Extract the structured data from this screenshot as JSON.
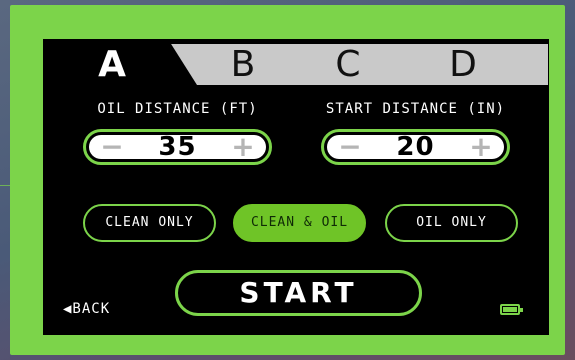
{
  "tabs": [
    {
      "label": "A",
      "active": true
    },
    {
      "label": "B",
      "active": false
    },
    {
      "label": "C",
      "active": false
    },
    {
      "label": "D",
      "active": false
    }
  ],
  "oil_distance": {
    "label": "OIL DISTANCE (FT)",
    "value": "35",
    "minus": "−",
    "plus": "+"
  },
  "start_distance": {
    "label": "START DISTANCE (IN)",
    "value": "20",
    "minus": "−",
    "plus": "+"
  },
  "modes": [
    {
      "label": "CLEAN ONLY",
      "selected": false
    },
    {
      "label": "CLEAN & OIL",
      "selected": true
    },
    {
      "label": "OIL ONLY",
      "selected": false
    }
  ],
  "start_label": "START",
  "back_label": "◀BACK",
  "battery": {
    "level": 1.0,
    "icon": "battery-full-icon"
  },
  "colors": {
    "accent": "#7cd44a",
    "selected": "#6fc427",
    "screen": "#000000",
    "tab_bar": "#c9c9c9"
  }
}
